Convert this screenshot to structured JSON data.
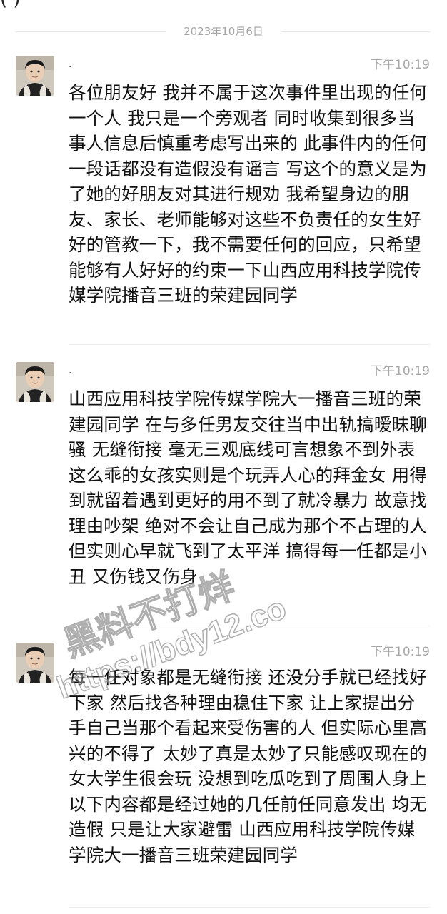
{
  "chat": {
    "top_fragment": "(          )",
    "date_separator": "2023年10月6日"
  },
  "messages": [
    {
      "sender": ".",
      "time": "下午10:19",
      "text": "各位朋友好 我并不属于这次事件里出现的任何一个人 我只是一个旁观者 同时收集到很多当事人信息后慎重考虑写出来的 此事件内的任何一段话都没有造假没有谣言 写这个的意义是为了她的好朋友对其进行规劝 我希望身边的朋友、家长、老师能够对这些不负责任的女生好好的管教一下，我不需要任何的回应，只希望能够有人好好的约束一下山西应用科技学院传媒学院播音三班的荣建园同学"
    },
    {
      "sender": ".",
      "time": "下午10:19",
      "text": "山西应用科技学院传媒学院大一播音三班的荣建园同学 在与多任男友交往当中出轨搞暧昧聊骚  无缝衔接 毫无三观底线可言想象不到外表这么乖的女孩实则是个玩弄人心的拜金女  用得到就留着遇到更好的用不到了就冷暴力 故意找理由吵架 绝对不会让自己成为那个不占理的人 但实则心早就飞到了太平洋 搞得每一任都是小丑 又伤钱又伤身"
    },
    {
      "sender": "",
      "time": "下午10:19",
      "text": "每一任对象都是无缝衔接 还没分手就已经找好下家 然后找各种理由稳住下家 让上家提出分手自己当那个看起来受伤害的人 但实际心里高兴的不得了 太妙了真是太妙了只能感叹现在的女大学生很会玩 没想到吃瓜吃到了周围人身上 以下内容都是经过她的几任前任同意发出  均无造假 只是让大家避雷  山西应用科技学院传媒学院大一播音三班荣建园同学"
    }
  ],
  "watermark": {
    "line1": "黑料不打烊",
    "line2": "https://bdy12.co"
  }
}
